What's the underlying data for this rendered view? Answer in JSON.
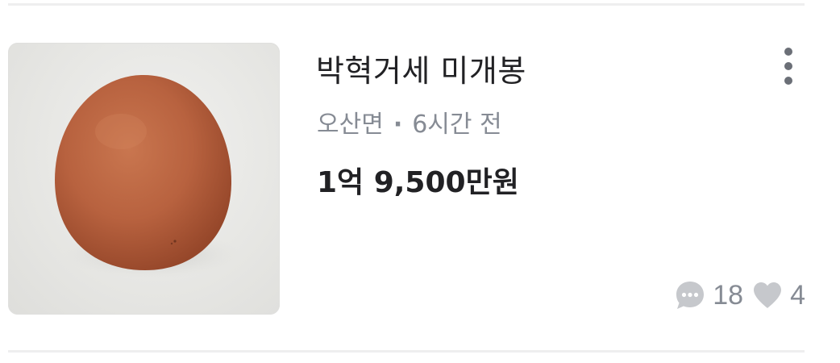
{
  "listing": {
    "title": "박혁거세 미개봉",
    "location": "오산면",
    "separator": "·",
    "time_ago": "6시간 전",
    "price": "1억 9,500만원",
    "chat_count": "18",
    "like_count": "4"
  },
  "icons": {
    "more": "more-vertical-icon",
    "chat": "chat-bubble-icon",
    "like": "heart-icon"
  },
  "colors": {
    "text_primary": "#212124",
    "text_secondary": "#868b94",
    "icon_gray": "#c6c8cc",
    "divider": "#eeeeef"
  }
}
